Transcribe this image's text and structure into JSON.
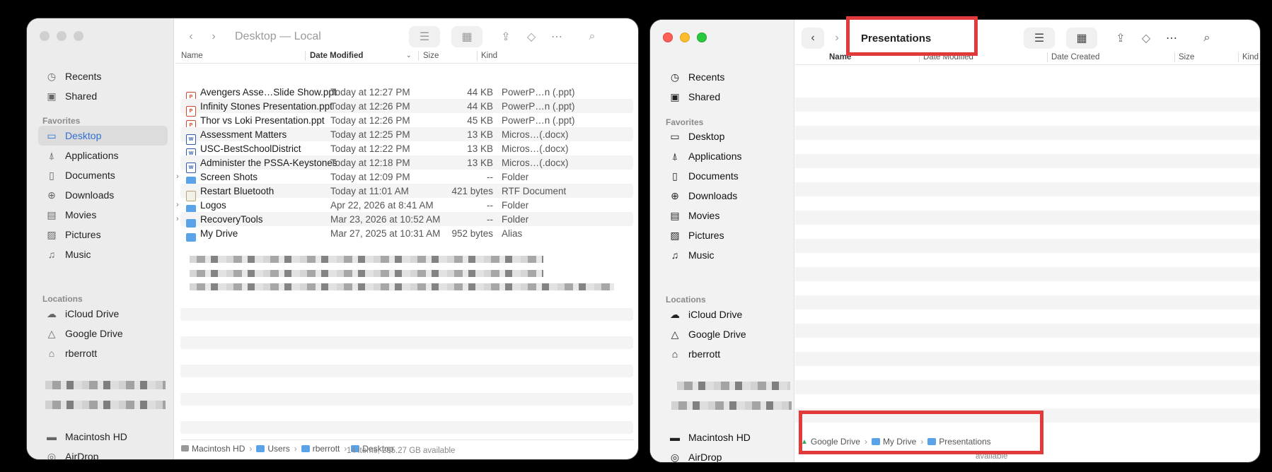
{
  "win1": {
    "title": "Desktop — Local",
    "sidebar": {
      "recents": "Recents",
      "shared": "Shared",
      "favorites_header": "Favorites",
      "favorites": [
        "Desktop",
        "Applications",
        "Documents",
        "Downloads",
        "Movies",
        "Pictures",
        "Music"
      ],
      "locations_header": "Locations",
      "locations": [
        "iCloud Drive",
        "Google Drive",
        "rberrott",
        "Macintosh HD",
        "AirDrop"
      ]
    },
    "columns": {
      "name": "Name",
      "date": "Date Modified",
      "size": "Size",
      "kind": "Kind"
    },
    "files": [
      {
        "name": "Avengers Asse…Slide Show.ppt",
        "date": "Today at 12:27 PM",
        "size": "44 KB",
        "kind": "PowerP…n (.ppt)",
        "icon": "ppt-icon"
      },
      {
        "name": "Infinity Stones Presentation.ppt",
        "date": "Today at 12:26 PM",
        "size": "44 KB",
        "kind": "PowerP…n (.ppt)",
        "icon": "ppt-icon"
      },
      {
        "name": "Thor vs Loki Presentation.ppt",
        "date": "Today at 12:26 PM",
        "size": "45 KB",
        "kind": "PowerP…n (.ppt)",
        "icon": "ppt-icon"
      },
      {
        "name": "Assessment Matters",
        "date": "Today at 12:25 PM",
        "size": "13 KB",
        "kind": "Micros…(.docx)",
        "icon": "docx-icon"
      },
      {
        "name": "USC-BestSchoolDistrict",
        "date": "Today at 12:22 PM",
        "size": "13 KB",
        "kind": "Micros…(.docx)",
        "icon": "docx-icon"
      },
      {
        "name": "Administer the PSSA-Keystones",
        "date": "Today at 12:18 PM",
        "size": "13 KB",
        "kind": "Micros…(.docx)",
        "icon": "docx-icon"
      },
      {
        "name": "Screen Shots",
        "date": "Today at 12:09 PM",
        "size": "--",
        "kind": "Folder",
        "icon": "folder-icon"
      },
      {
        "name": "Restart Bluetooth",
        "date": "Today at 11:01 AM",
        "size": "421 bytes",
        "kind": "RTF Document",
        "icon": "rtf-icon"
      },
      {
        "name": "Logos",
        "date": "Apr 22, 2026 at 8:41 AM",
        "size": "--",
        "kind": "Folder",
        "icon": "folder-icon"
      },
      {
        "name": "RecoveryTools",
        "date": "Mar 23, 2026 at 10:52 AM",
        "size": "--",
        "kind": "Folder",
        "icon": "folder-icon"
      },
      {
        "name": "My Drive",
        "date": "Mar 27, 2025 at 10:31 AM",
        "size": "952 bytes",
        "kind": "Alias",
        "icon": "alias-folder-icon"
      }
    ],
    "path": [
      "Macintosh HD",
      "Users",
      "rberrott",
      "Desktop"
    ],
    "status": "14 items, 295.27 GB available"
  },
  "win2": {
    "title": "Presentations",
    "sidebar": {
      "recents": "Recents",
      "shared": "Shared",
      "favorites_header": "Favorites",
      "favorites": [
        "Desktop",
        "Applications",
        "Documents",
        "Downloads",
        "Movies",
        "Pictures",
        "Music"
      ],
      "locations_header": "Locations",
      "locations": [
        "iCloud Drive",
        "Google Drive",
        "rberrott",
        "Macintosh HD",
        "AirDrop"
      ]
    },
    "columns": {
      "name": "Name",
      "date_modified": "Date Modified",
      "date_created": "Date Created",
      "size": "Size",
      "kind": "Kind"
    },
    "path": [
      "Google Drive",
      "My Drive",
      "Presentations"
    ],
    "status": "available"
  },
  "colors": {
    "highlight_red": "#e03a3a",
    "selection_blue": "#2f6fd6",
    "folder_blue": "#5aa3e8"
  }
}
